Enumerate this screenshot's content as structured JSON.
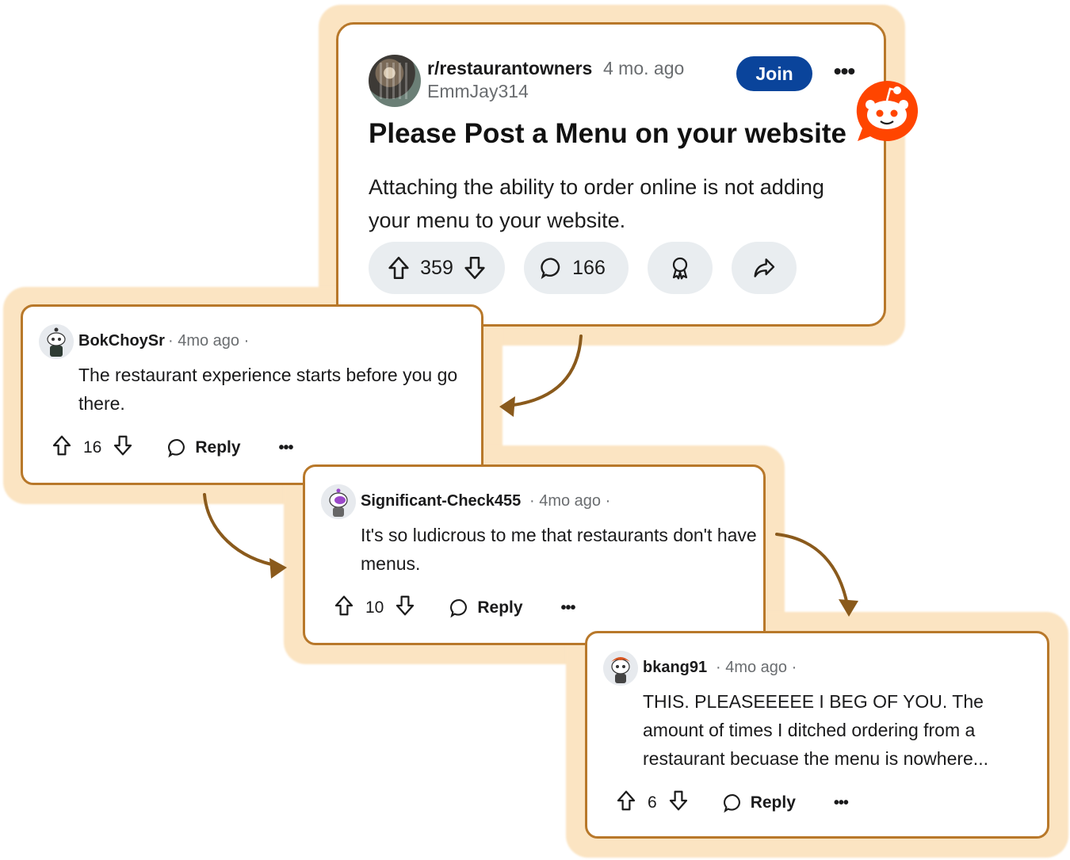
{
  "post": {
    "subreddit": "r/restaurantowners",
    "time": "4 mo. ago",
    "author": "EmmJay314",
    "join_label": "Join",
    "more_label": "•••",
    "title": "Please Post a Menu on your website",
    "body": "Attaching the ability to order online is not adding your menu to your website.",
    "votes": "359",
    "comments": "166",
    "icons": [
      "upvote-icon",
      "downvote-icon",
      "comment-icon",
      "award-icon",
      "share-icon"
    ]
  },
  "badge": {
    "icon": "reddit-snoo-icon",
    "color": "#ff4500"
  },
  "comments": [
    {
      "user": "BokChoySr",
      "meta": "· 4mo ago ·",
      "body": "The restaurant experience starts before you go there.",
      "votes": "16",
      "reply_label": "Reply",
      "more_label": "•••"
    },
    {
      "user": "Significant-Check455",
      "meta": "· 4mo ago ·",
      "body": "It's so ludicrous to me that restaurants don't have menus.",
      "votes": "10",
      "reply_label": "Reply",
      "more_label": "•••"
    },
    {
      "user": "bkang91",
      "meta": "· 4mo ago ·",
      "body": "THIS. PLEASEEEEE I BEG OF YOU. The amount of times I ditched ordering from a restaurant becuase the menu is nowhere...",
      "votes": "6",
      "reply_label": "Reply",
      "more_label": "•••"
    }
  ],
  "colors": {
    "border": "#b8782a",
    "glow": "#fbe4c2",
    "join": "#0a449b",
    "arrow": "#8a5a1c",
    "pill": "#e9edf0"
  }
}
